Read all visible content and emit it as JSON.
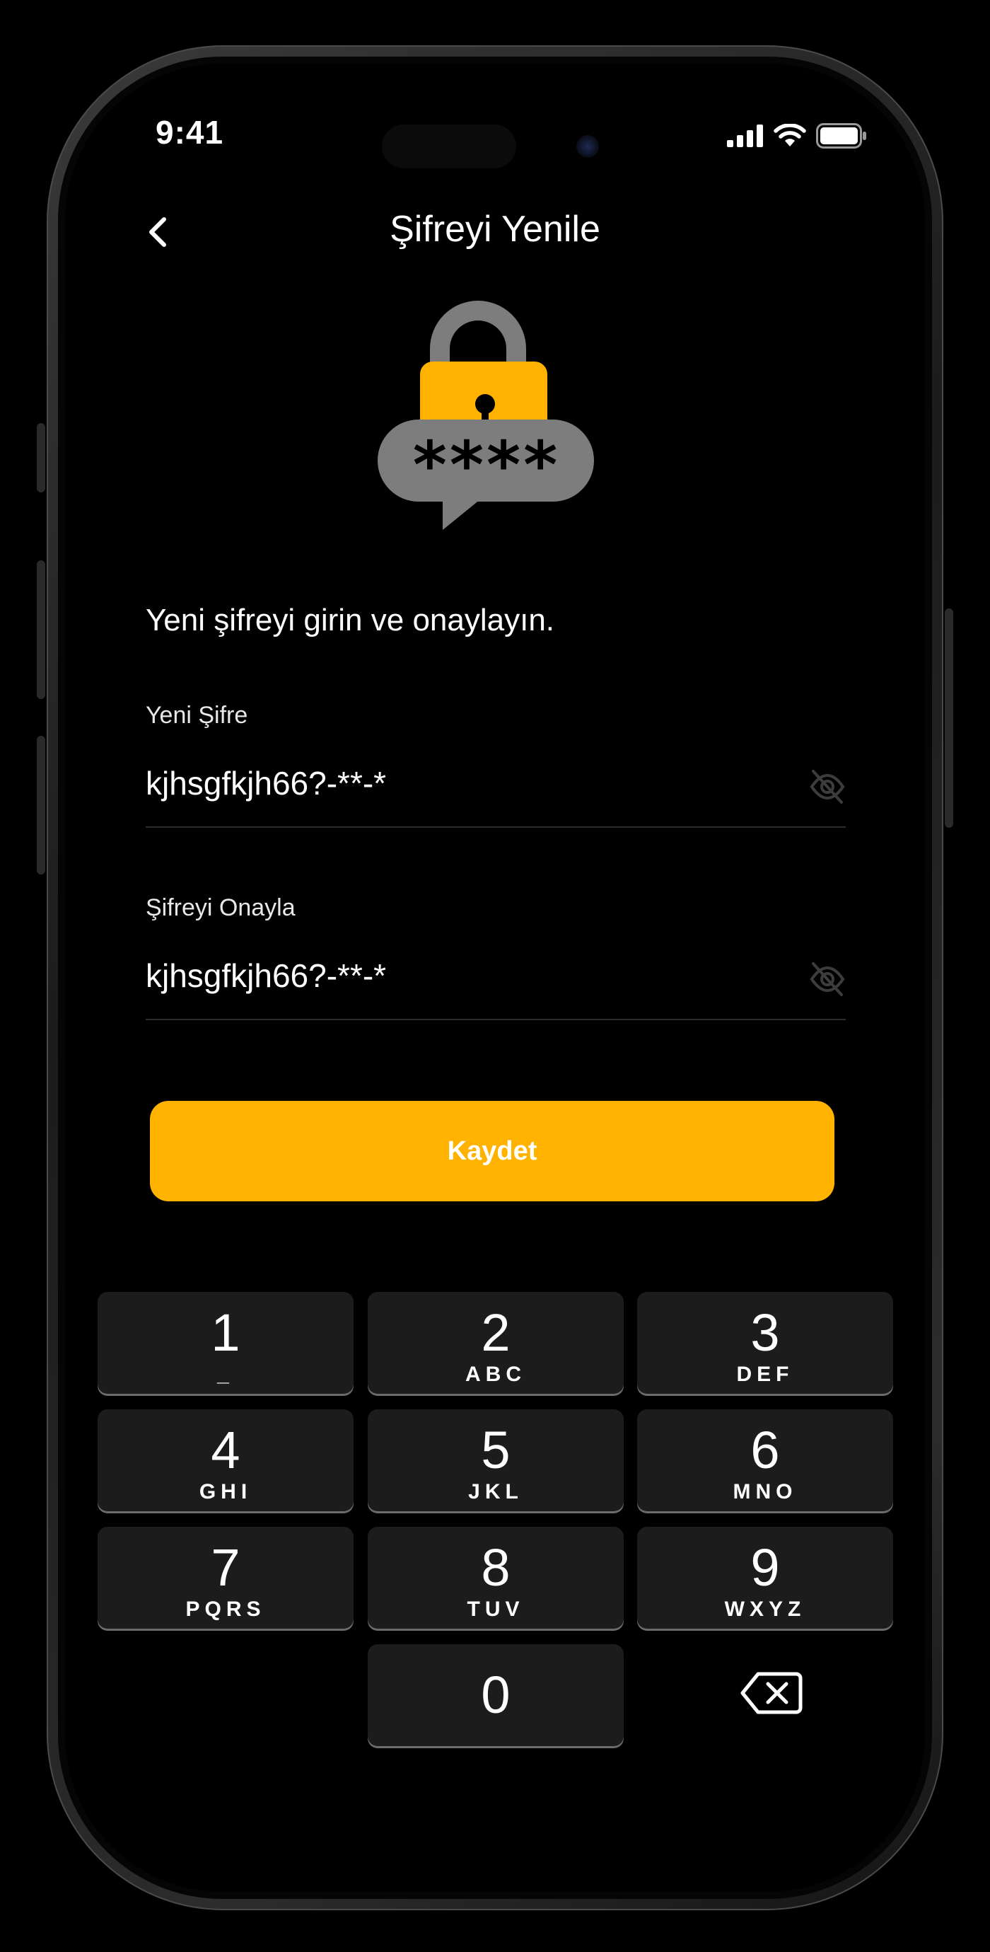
{
  "status_bar": {
    "time": "9:41"
  },
  "header": {
    "title": "Şifreyi Yenile"
  },
  "instruction": "Yeni şifreyi girin ve onaylayın.",
  "fields": {
    "new_password": {
      "label": "Yeni Şifre",
      "value": "kjhsgfkjh66?-**-*"
    },
    "confirm_password": {
      "label": "Şifreyi Onayla",
      "value": "kjhsgfkjh66?-**-*"
    }
  },
  "save_label": "Kaydet",
  "illustration": {
    "mask": "****"
  },
  "keypad": {
    "keys": [
      {
        "digit": "1",
        "letters": "_"
      },
      {
        "digit": "2",
        "letters": "ABC"
      },
      {
        "digit": "3",
        "letters": "DEF"
      },
      {
        "digit": "4",
        "letters": "GHI"
      },
      {
        "digit": "5",
        "letters": "JKL"
      },
      {
        "digit": "6",
        "letters": "MNO"
      },
      {
        "digit": "7",
        "letters": "PQRS"
      },
      {
        "digit": "8",
        "letters": "TUV"
      },
      {
        "digit": "9",
        "letters": "WXYZ"
      },
      {
        "digit": "0",
        "letters": ""
      }
    ]
  },
  "colors": {
    "accent": "#FFB300",
    "background": "#000000",
    "key_background": "#1C1C1C"
  },
  "icons": [
    "back-chevron-icon",
    "lock-icon",
    "eye-off-icon",
    "backspace-icon",
    "signal-icon",
    "wifi-icon",
    "battery-icon"
  ]
}
